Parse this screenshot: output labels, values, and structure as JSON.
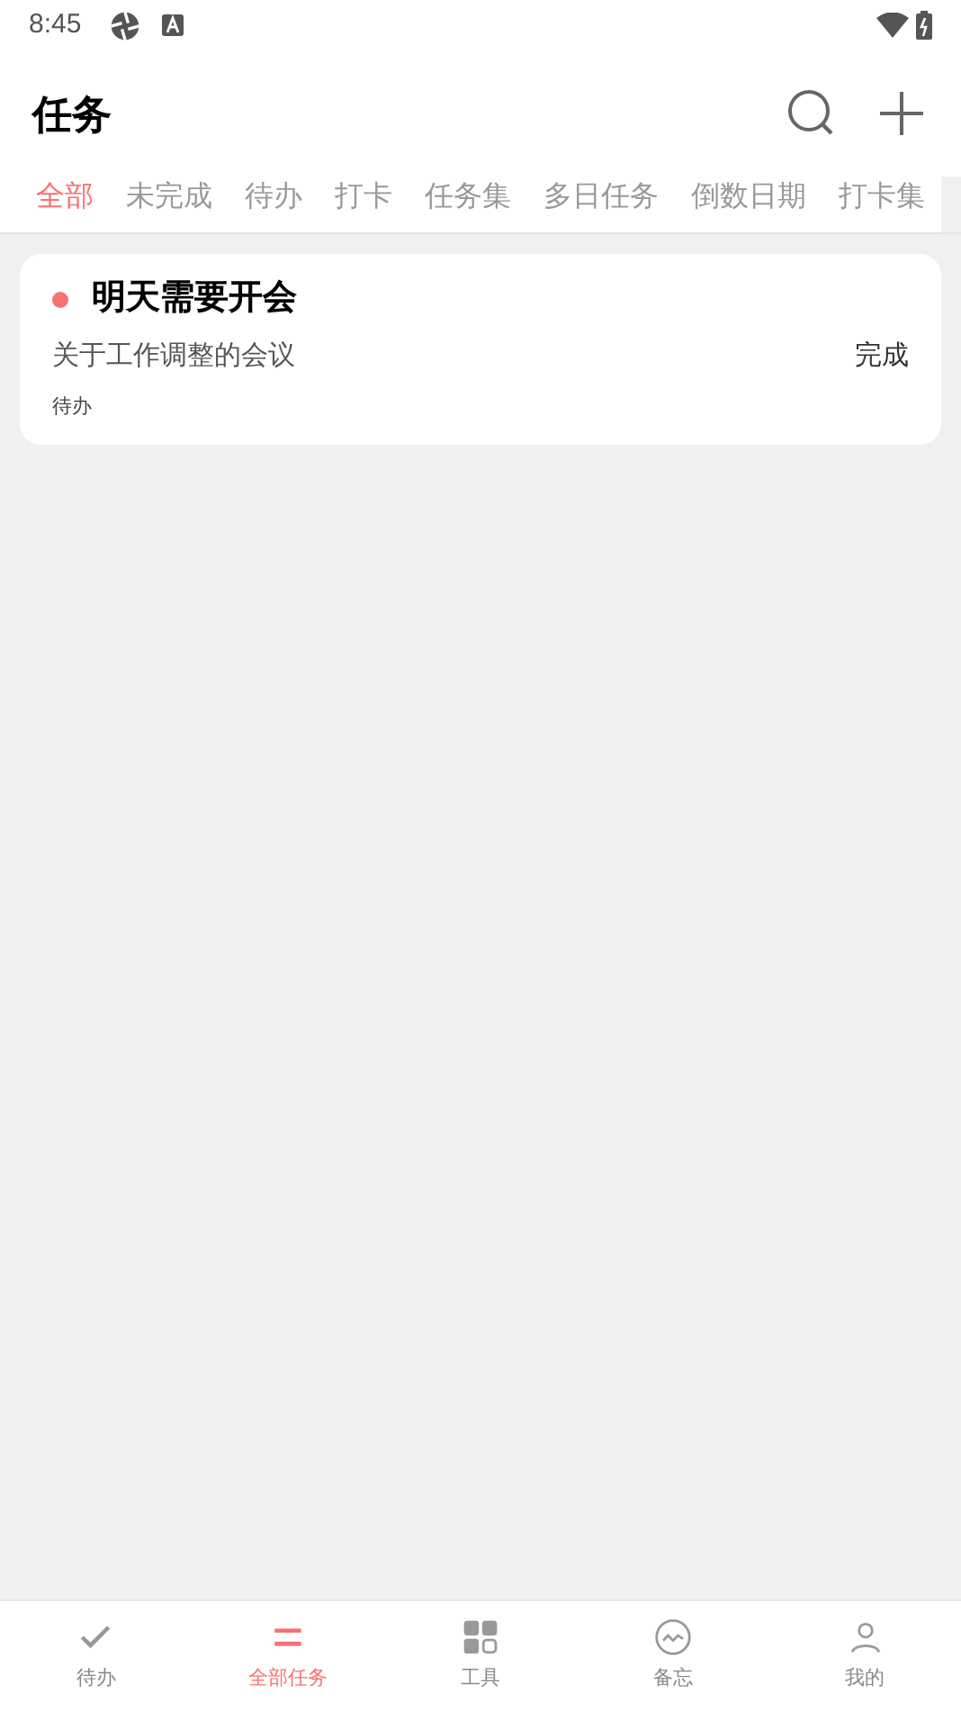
{
  "status_bar": {
    "time": "8:45"
  },
  "header": {
    "title": "任务"
  },
  "tabs": [
    {
      "label": "全部",
      "selected": true
    },
    {
      "label": "未完成",
      "selected": false
    },
    {
      "label": "待办",
      "selected": false
    },
    {
      "label": "打卡",
      "selected": false
    },
    {
      "label": "任务集",
      "selected": false
    },
    {
      "label": "多日任务",
      "selected": false
    },
    {
      "label": "倒数日期",
      "selected": false
    },
    {
      "label": "打卡集",
      "selected": false
    }
  ],
  "tasks": [
    {
      "title": "明天需要开会",
      "color": "#f87171",
      "description": "关于工作调整的会议",
      "action": "完成",
      "tag": "待办"
    }
  ],
  "bottom_nav": [
    {
      "label": "待办",
      "kind": "check",
      "selected": false
    },
    {
      "label": "全部任务",
      "kind": "list",
      "selected": true
    },
    {
      "label": "工具",
      "kind": "grid",
      "selected": false
    },
    {
      "label": "备忘",
      "kind": "memo",
      "selected": false
    },
    {
      "label": "我的",
      "kind": "user",
      "selected": false
    }
  ]
}
